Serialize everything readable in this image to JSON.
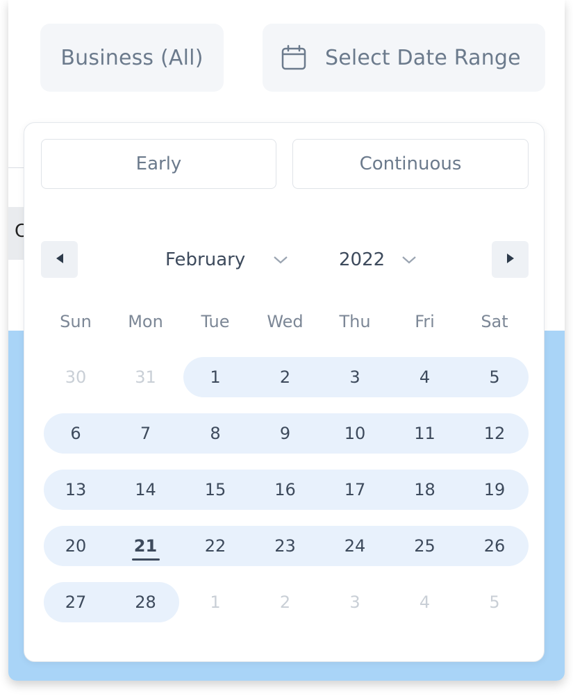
{
  "filters": {
    "business_label": "Business (All)",
    "date_range_label": "Select Date Range"
  },
  "background": {
    "partial_letter": "C"
  },
  "picker": {
    "modes": [
      "Early",
      "Continuous"
    ],
    "month": "February",
    "year": "2022",
    "weekdays": [
      "Sun",
      "Mon",
      "Tue",
      "Wed",
      "Thu",
      "Fri",
      "Sat"
    ],
    "weeks": [
      [
        {
          "d": "30",
          "cur": false
        },
        {
          "d": "31",
          "cur": false
        },
        {
          "d": "1",
          "cur": true
        },
        {
          "d": "2",
          "cur": true
        },
        {
          "d": "3",
          "cur": true
        },
        {
          "d": "4",
          "cur": true
        },
        {
          "d": "5",
          "cur": true
        }
      ],
      [
        {
          "d": "6",
          "cur": true
        },
        {
          "d": "7",
          "cur": true
        },
        {
          "d": "8",
          "cur": true
        },
        {
          "d": "9",
          "cur": true
        },
        {
          "d": "10",
          "cur": true
        },
        {
          "d": "11",
          "cur": true
        },
        {
          "d": "12",
          "cur": true
        }
      ],
      [
        {
          "d": "13",
          "cur": true
        },
        {
          "d": "14",
          "cur": true
        },
        {
          "d": "15",
          "cur": true
        },
        {
          "d": "16",
          "cur": true
        },
        {
          "d": "17",
          "cur": true
        },
        {
          "d": "18",
          "cur": true
        },
        {
          "d": "19",
          "cur": true
        }
      ],
      [
        {
          "d": "20",
          "cur": true
        },
        {
          "d": "21",
          "cur": true
        },
        {
          "d": "22",
          "cur": true
        },
        {
          "d": "23",
          "cur": true
        },
        {
          "d": "24",
          "cur": true
        },
        {
          "d": "25",
          "cur": true
        },
        {
          "d": "26",
          "cur": true
        }
      ],
      [
        {
          "d": "27",
          "cur": true
        },
        {
          "d": "28",
          "cur": true
        },
        {
          "d": "1",
          "cur": false
        },
        {
          "d": "2",
          "cur": false
        },
        {
          "d": "3",
          "cur": false
        },
        {
          "d": "4",
          "cur": false
        },
        {
          "d": "5",
          "cur": false
        }
      ]
    ],
    "today": "21",
    "icons": {
      "prev": "caret-left-icon",
      "next": "caret-right-icon",
      "month_dropdown": "chevron-down-icon",
      "year_dropdown": "chevron-down-icon",
      "calendar": "calendar-icon"
    },
    "colors": {
      "range_highlight": "#e8f1fc",
      "text": "#3d4a5c",
      "muted": "#c9cfd6",
      "background_accent": "#a9d4f7"
    }
  }
}
